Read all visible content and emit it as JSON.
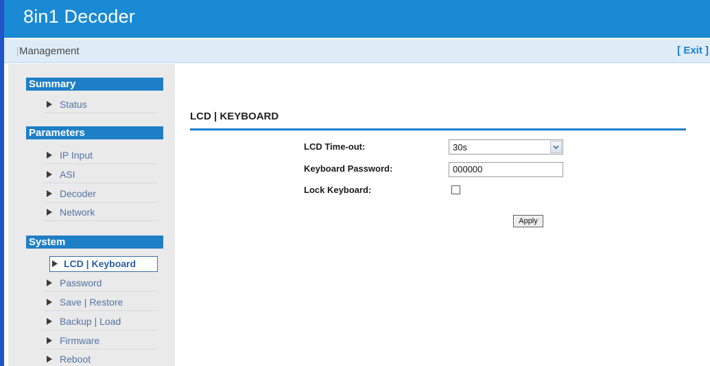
{
  "app": {
    "title": "8in1 Decoder"
  },
  "subbar": {
    "title": "Management",
    "exit_label": "[ Exit ]"
  },
  "sidebar": {
    "sections": [
      {
        "title": "Summary",
        "items": [
          {
            "label": "Status"
          }
        ]
      },
      {
        "title": "Parameters",
        "items": [
          {
            "label": "IP Input"
          },
          {
            "label": "ASI"
          },
          {
            "label": "Decoder"
          },
          {
            "label": "Network"
          }
        ]
      },
      {
        "title": "System",
        "items": [
          {
            "label": "LCD | Keyboard",
            "active": true
          },
          {
            "label": "Password"
          },
          {
            "label": "Save | Restore"
          },
          {
            "label": "Backup | Load"
          },
          {
            "label": "Firmware"
          },
          {
            "label": "Reboot"
          }
        ]
      }
    ]
  },
  "main": {
    "title": "LCD | KEYBOARD",
    "form": {
      "lcd_timeout": {
        "label": "LCD Time-out:",
        "value": "30s"
      },
      "keyboard_password": {
        "label": "Keyboard Password:",
        "value": "000000"
      },
      "lock_keyboard": {
        "label": "Lock Keyboard:",
        "checked": false
      },
      "apply_label": "Apply"
    }
  },
  "colors": {
    "header": "#1a8ad4",
    "accent": "#1f7fc6",
    "subbar": "#deecf7",
    "sidebar": "#eaeaea",
    "left_strip": "#1f55c8"
  },
  "icons": {
    "nav_arrow": "triangle-right-icon",
    "select_arrow": "chevron-down-icon"
  }
}
